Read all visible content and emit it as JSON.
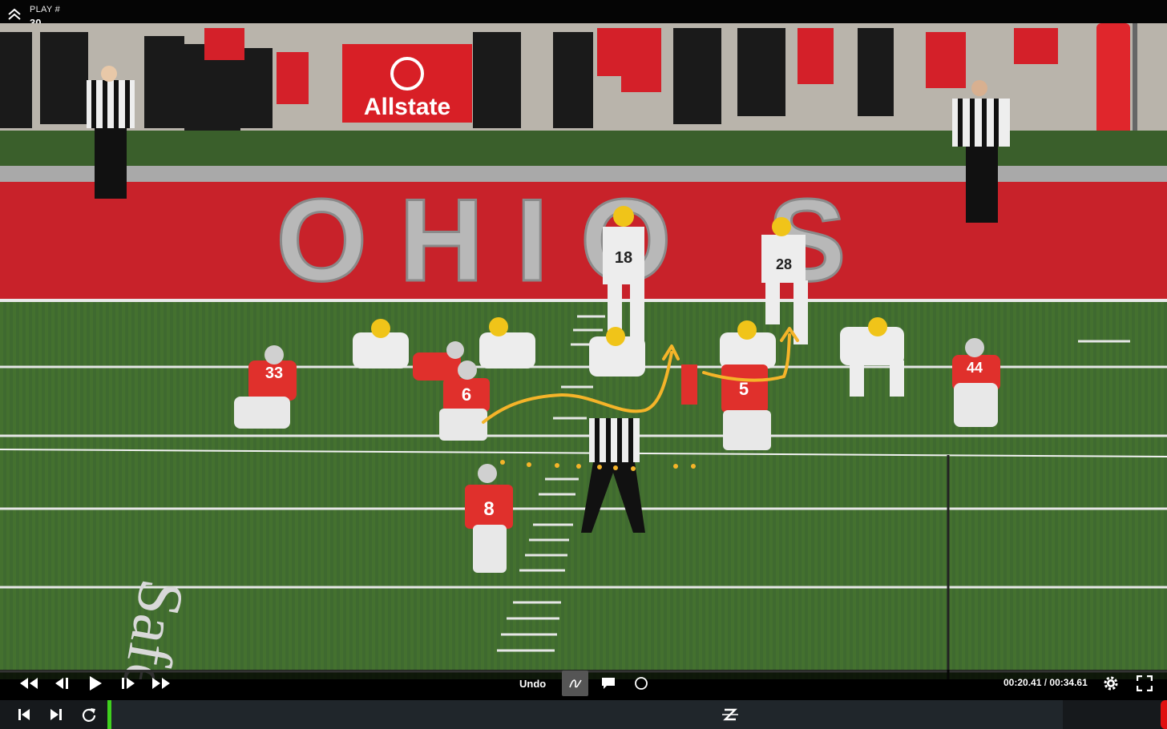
{
  "header": {
    "play_label": "PLAY #",
    "play_number": "30"
  },
  "scene": {
    "sponsor": "Allstate",
    "endzone_text": "OHIO S",
    "field_text": "Safe",
    "jerseys": {
      "offense_qb": "18",
      "offense_rb": "28",
      "defense_left": "33",
      "defense_lb": "6",
      "defense_mid": "5",
      "defense_right": "44",
      "defense_safety": "8"
    },
    "colors": {
      "turf": "#3f6a30",
      "red": "#d81f26",
      "annotation": "#f5b429",
      "timeline_progress": "#3fd01e"
    }
  },
  "controls": {
    "undo_label": "Undo",
    "current_time": "00:20.41",
    "separator": "/",
    "total_time": "00:34.61",
    "icons": [
      "rewind-icon",
      "step-back-icon",
      "play-icon",
      "step-forward-icon",
      "fast-forward-icon",
      "pen-icon",
      "comment-icon",
      "circle-icon",
      "settings-icon",
      "fullscreen-icon",
      "skip-start-icon",
      "skip-end-icon",
      "replay-icon",
      "logo-icon"
    ]
  }
}
